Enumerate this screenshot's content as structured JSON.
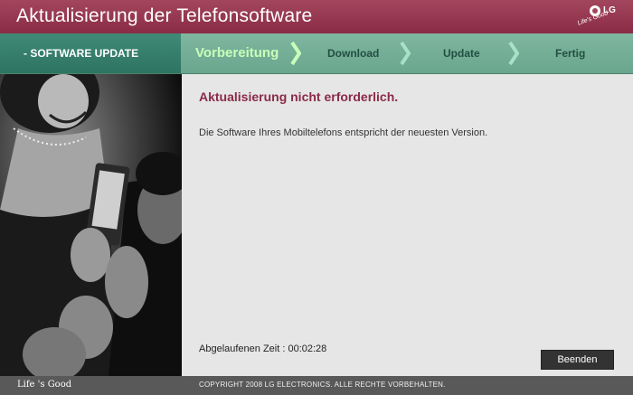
{
  "window": {
    "title": "Aktualisierung der Telefonsoftware",
    "logo_text": "LG",
    "logo_slogan": "Life's Good"
  },
  "stepbar": {
    "section_label": "- SOFTWARE UPDATE",
    "steps": [
      {
        "label": "Vorbereitung",
        "active": true
      },
      {
        "label": "Download",
        "active": false
      },
      {
        "label": "Update",
        "active": false
      },
      {
        "label": "Fertig",
        "active": false
      }
    ]
  },
  "content": {
    "headline": "Aktualisierung nicht erforderlich.",
    "message": "Die Software Ihres Mobiltelefons entspricht der neuesten Version.",
    "elapsed_label": "Abgelaufenen Zeit :",
    "elapsed_value": "00:02:28",
    "exit_button": "Beenden"
  },
  "footer": {
    "slogan": "Life 's Good",
    "copyright": "COPYRIGHT 2008  LG ELECTRONICS. ALLE RECHTE VORBEHALTEN."
  },
  "colors": {
    "title_bar": "#8a2b45",
    "step_bar": "#6aa68e",
    "headline": "#8b2a48",
    "active_step": "#c8ffb8"
  }
}
